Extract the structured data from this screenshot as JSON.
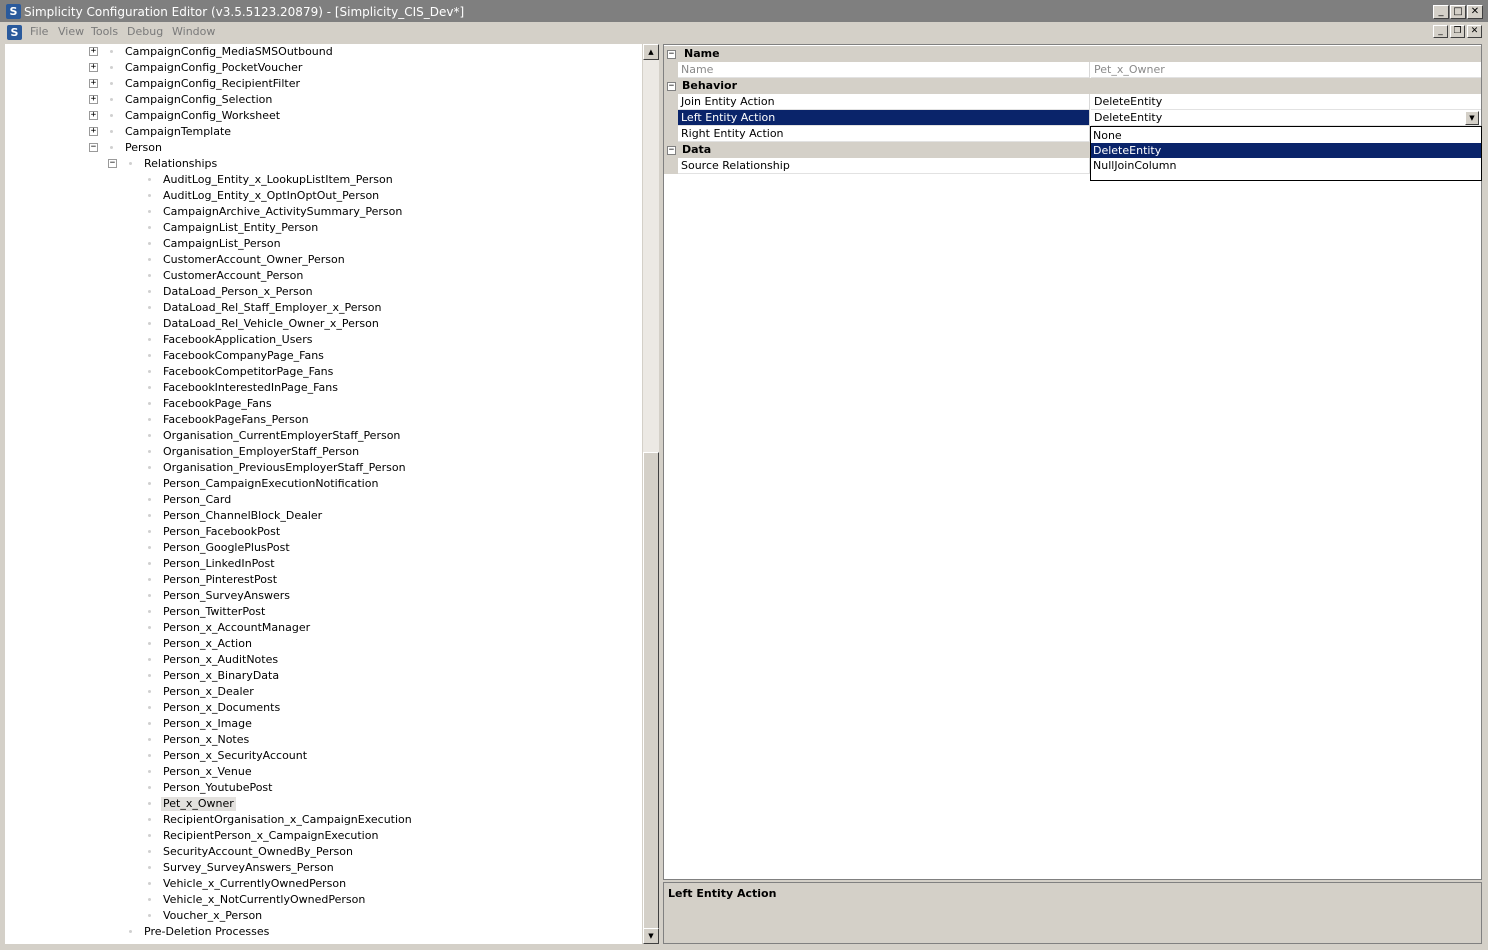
{
  "window": {
    "title": "Simplicity Configuration Editor (v3.5.5123.20879) - [Simplicity_CIS_Dev*]",
    "app_icon_letter": "S",
    "caption_buttons": [
      "_",
      "□",
      "✕"
    ]
  },
  "menubar": {
    "items": [
      "File",
      "View",
      "Tools",
      "Debug",
      "Window"
    ],
    "mdi_buttons": [
      "_",
      "❐",
      "✕"
    ]
  },
  "tree": {
    "top_nodes": [
      {
        "label": "CampaignConfig_MediaSMSOutbound",
        "expander": "+"
      },
      {
        "label": "CampaignConfig_PocketVoucher",
        "expander": "+"
      },
      {
        "label": "CampaignConfig_RecipientFilter",
        "expander": "+"
      },
      {
        "label": "CampaignConfig_Selection",
        "expander": "+"
      },
      {
        "label": "CampaignConfig_Worksheet",
        "expander": "+"
      },
      {
        "label": "CampaignTemplate",
        "expander": "+"
      },
      {
        "label": "Person",
        "expander": "−"
      }
    ],
    "relationships_label": "Relationships",
    "relationships_expander": "−",
    "relationships": [
      "AuditLog_Entity_x_LookupListItem_Person",
      "AuditLog_Entity_x_OptInOptOut_Person",
      "CampaignArchive_ActivitySummary_Person",
      "CampaignList_Entity_Person",
      "CampaignList_Person",
      "CustomerAccount_Owner_Person",
      "CustomerAccount_Person",
      "DataLoad_Person_x_Person",
      "DataLoad_Rel_Staff_Employer_x_Person",
      "DataLoad_Rel_Vehicle_Owner_x_Person",
      "FacebookApplication_Users",
      "FacebookCompanyPage_Fans",
      "FacebookCompetitorPage_Fans",
      "FacebookInterestedInPage_Fans",
      "FacebookPage_Fans",
      "FacebookPageFans_Person",
      "Organisation_CurrentEmployerStaff_Person",
      "Organisation_EmployerStaff_Person",
      "Organisation_PreviousEmployerStaff_Person",
      "Person_CampaignExecutionNotification",
      "Person_Card",
      "Person_ChannelBlock_Dealer",
      "Person_FacebookPost",
      "Person_GooglePlusPost",
      "Person_LinkedInPost",
      "Person_PinterestPost",
      "Person_SurveyAnswers",
      "Person_TwitterPost",
      "Person_x_AccountManager",
      "Person_x_Action",
      "Person_x_AuditNotes",
      "Person_x_BinaryData",
      "Person_x_Dealer",
      "Person_x_Documents",
      "Person_x_Image",
      "Person_x_Notes",
      "Person_x_SecurityAccount",
      "Person_x_Venue",
      "Person_YoutubePost",
      "Pet_x_Owner",
      "RecipientOrganisation_x_CampaignExecution",
      "RecipientPerson_x_CampaignExecution",
      "SecurityAccount_OwnedBy_Person",
      "Survey_SurveyAnswers_Person",
      "Vehicle_x_CurrentlyOwnedPerson",
      "Vehicle_x_NotCurrentlyOwnedPerson",
      "Voucher_x_Person"
    ],
    "selected_relationship": "Pet_x_Owner",
    "pre_deletion_label": "Pre-Deletion Processes"
  },
  "scrollbar": {
    "up_arrow": "▲",
    "down_arrow": "▼"
  },
  "property_grid": {
    "name_category": {
      "label": "Name",
      "expander": "−"
    },
    "name_row": {
      "name": "Name",
      "value": "Pet_x_Owner"
    },
    "behavior_category": {
      "label": "Behavior",
      "expander": "−"
    },
    "join_row": {
      "name": "Join Entity Action",
      "value": "DeleteEntity"
    },
    "left_row": {
      "name": "Left Entity Action",
      "value": "DeleteEntity"
    },
    "right_row": {
      "name": "Right Entity Action",
      "value": ""
    },
    "data_category": {
      "label": "Data",
      "expander": "−"
    },
    "source_row": {
      "name": "Source Relationship",
      "value": ""
    },
    "dropdown_arrow": "▼",
    "dropdown_options": [
      "None",
      "DeleteEntity",
      "NullJoinColumn"
    ],
    "dropdown_selected": "DeleteEntity"
  },
  "help": {
    "title": "Left Entity Action"
  },
  "colors": {
    "selection": "#0a246a",
    "chrome": "#d4d0c8",
    "titlebar": "#7f7f7f"
  }
}
